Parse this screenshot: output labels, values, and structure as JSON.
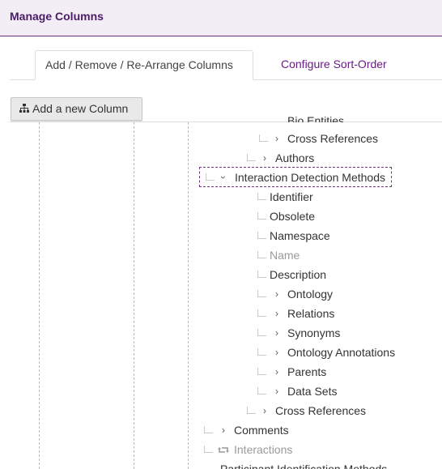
{
  "header": {
    "title": "Manage Columns"
  },
  "tabs": [
    {
      "label": "Add / Remove / Re-Arrange Columns",
      "active": true
    },
    {
      "label": "Configure Sort-Order",
      "active": false
    }
  ],
  "toolbar": {
    "add_column_label": "Add a new Column",
    "add_column_icon": "sitemap-icon"
  },
  "tree": {
    "partial_top": "Bio Entities",
    "nodes": [
      {
        "label": "Cross References",
        "expandable": true,
        "expanded": false,
        "disabled": false
      },
      {
        "label": "Authors",
        "expandable": true,
        "expanded": false,
        "disabled": false
      },
      {
        "label": "Interaction Detection Methods",
        "expandable": true,
        "expanded": true,
        "selected": true,
        "disabled": false
      },
      {
        "label": "Identifier",
        "expandable": false,
        "disabled": false
      },
      {
        "label": "Obsolete",
        "expandable": false,
        "disabled": false
      },
      {
        "label": "Namespace",
        "expandable": false,
        "disabled": false
      },
      {
        "label": "Name",
        "expandable": false,
        "disabled": true
      },
      {
        "label": "Description",
        "expandable": false,
        "disabled": false
      },
      {
        "label": "Ontology",
        "expandable": true,
        "expanded": false,
        "disabled": false
      },
      {
        "label": "Relations",
        "expandable": true,
        "expanded": false,
        "disabled": false
      },
      {
        "label": "Synonyms",
        "expandable": true,
        "expanded": false,
        "disabled": false
      },
      {
        "label": "Ontology Annotations",
        "expandable": true,
        "expanded": false,
        "disabled": false
      },
      {
        "label": "Parents",
        "expandable": true,
        "expanded": false,
        "disabled": false
      },
      {
        "label": "Data Sets",
        "expandable": true,
        "expanded": false,
        "disabled": false
      },
      {
        "label": "Cross References",
        "expandable": true,
        "expanded": false,
        "disabled": false
      },
      {
        "label": "Comments",
        "expandable": true,
        "expanded": false,
        "disabled": false
      },
      {
        "label": "Interactions",
        "expandable": false,
        "disabled": true,
        "icon": "retweet-icon"
      }
    ],
    "partial_bottom": "Participant Identification Methods"
  },
  "colors": {
    "brand": "#6b1a86",
    "header_bg": "#f3eef6",
    "muted": "#9a9a9a"
  }
}
